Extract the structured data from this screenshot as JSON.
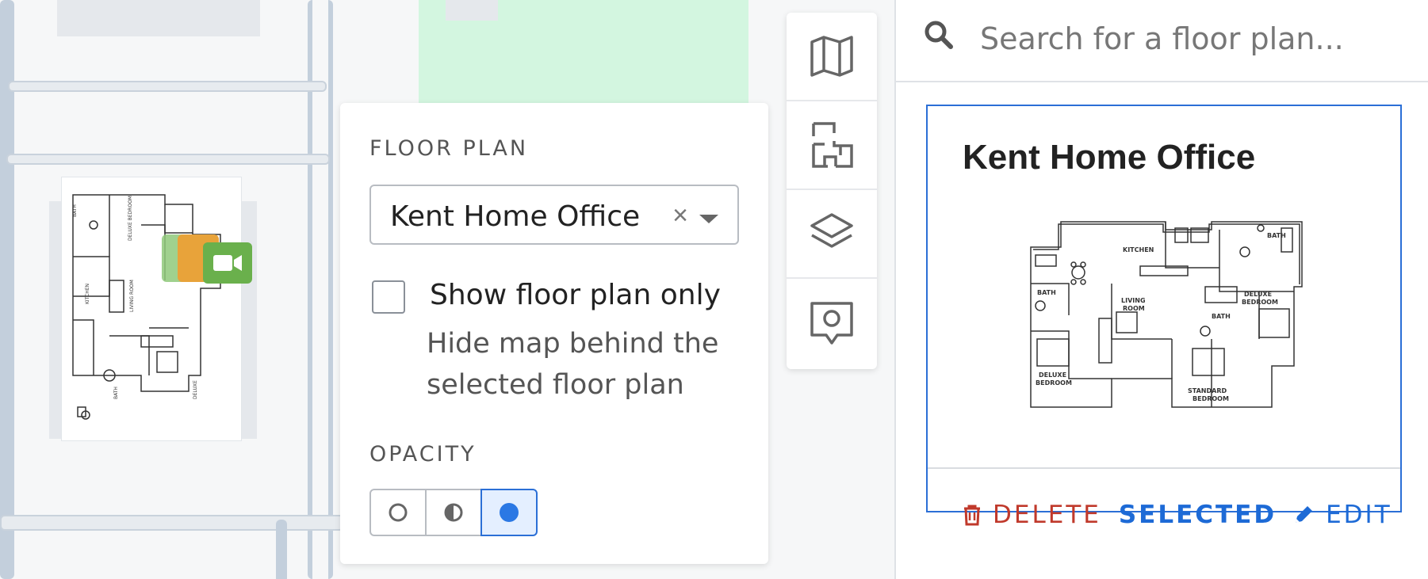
{
  "map": {
    "floor_plan_thumbnail": "floor-plan-overlay"
  },
  "panel": {
    "floor_plan_label": "FLOOR PLAN",
    "selected_floor_plan": "Kent Home Office",
    "clear_symbol": "×",
    "show_only_label": "Show floor plan only",
    "show_only_help": "Hide map behind the selected floor plan",
    "show_only_checked": false,
    "opacity_label": "OPACITY",
    "opacity_options": [
      "transparent",
      "half",
      "opaque"
    ],
    "opacity_selected": "opaque"
  },
  "toolbar": {
    "tools": [
      "map-icon",
      "floor-plan-icon",
      "layers-icon",
      "location-marker-icon"
    ]
  },
  "sidebar": {
    "search_placeholder": "Search for a floor plan...",
    "card": {
      "title": "Kent Home Office",
      "delete_label": "DELETE",
      "selected_label": "SELECTED",
      "edit_label": "EDIT"
    }
  },
  "colors": {
    "accent": "#2b6fd6",
    "danger": "#c0392b",
    "map_green": "#d3f6e0",
    "camera_green": "#6ab04c",
    "camera_orange": "#e8a33a"
  }
}
